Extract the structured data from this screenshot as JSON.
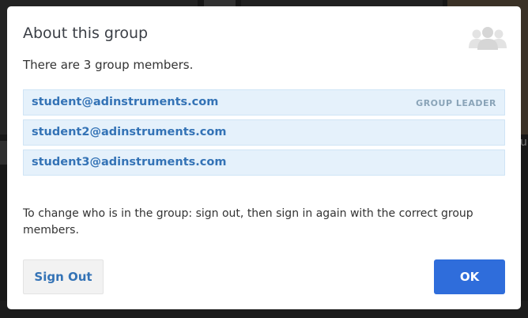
{
  "background": {
    "partial_label": "ul"
  },
  "dialog": {
    "title": "About this group",
    "icon": "group-icon",
    "members_summary": "There are 3 group members.",
    "members": [
      {
        "email": "student@adinstruments.com",
        "role": "GROUP LEADER"
      },
      {
        "email": "student2@adinstruments.com",
        "role": ""
      },
      {
        "email": "student3@adinstruments.com",
        "role": ""
      }
    ],
    "note": "To change who is in the group: sign out, then sign in again with the correct group members.",
    "sign_out_label": "Sign Out",
    "ok_label": "OK"
  },
  "colors": {
    "accent": "#2f6ddb",
    "link_text": "#3473b6",
    "row_background": "#e5f1fb",
    "badge_text": "#8aa4b8"
  }
}
